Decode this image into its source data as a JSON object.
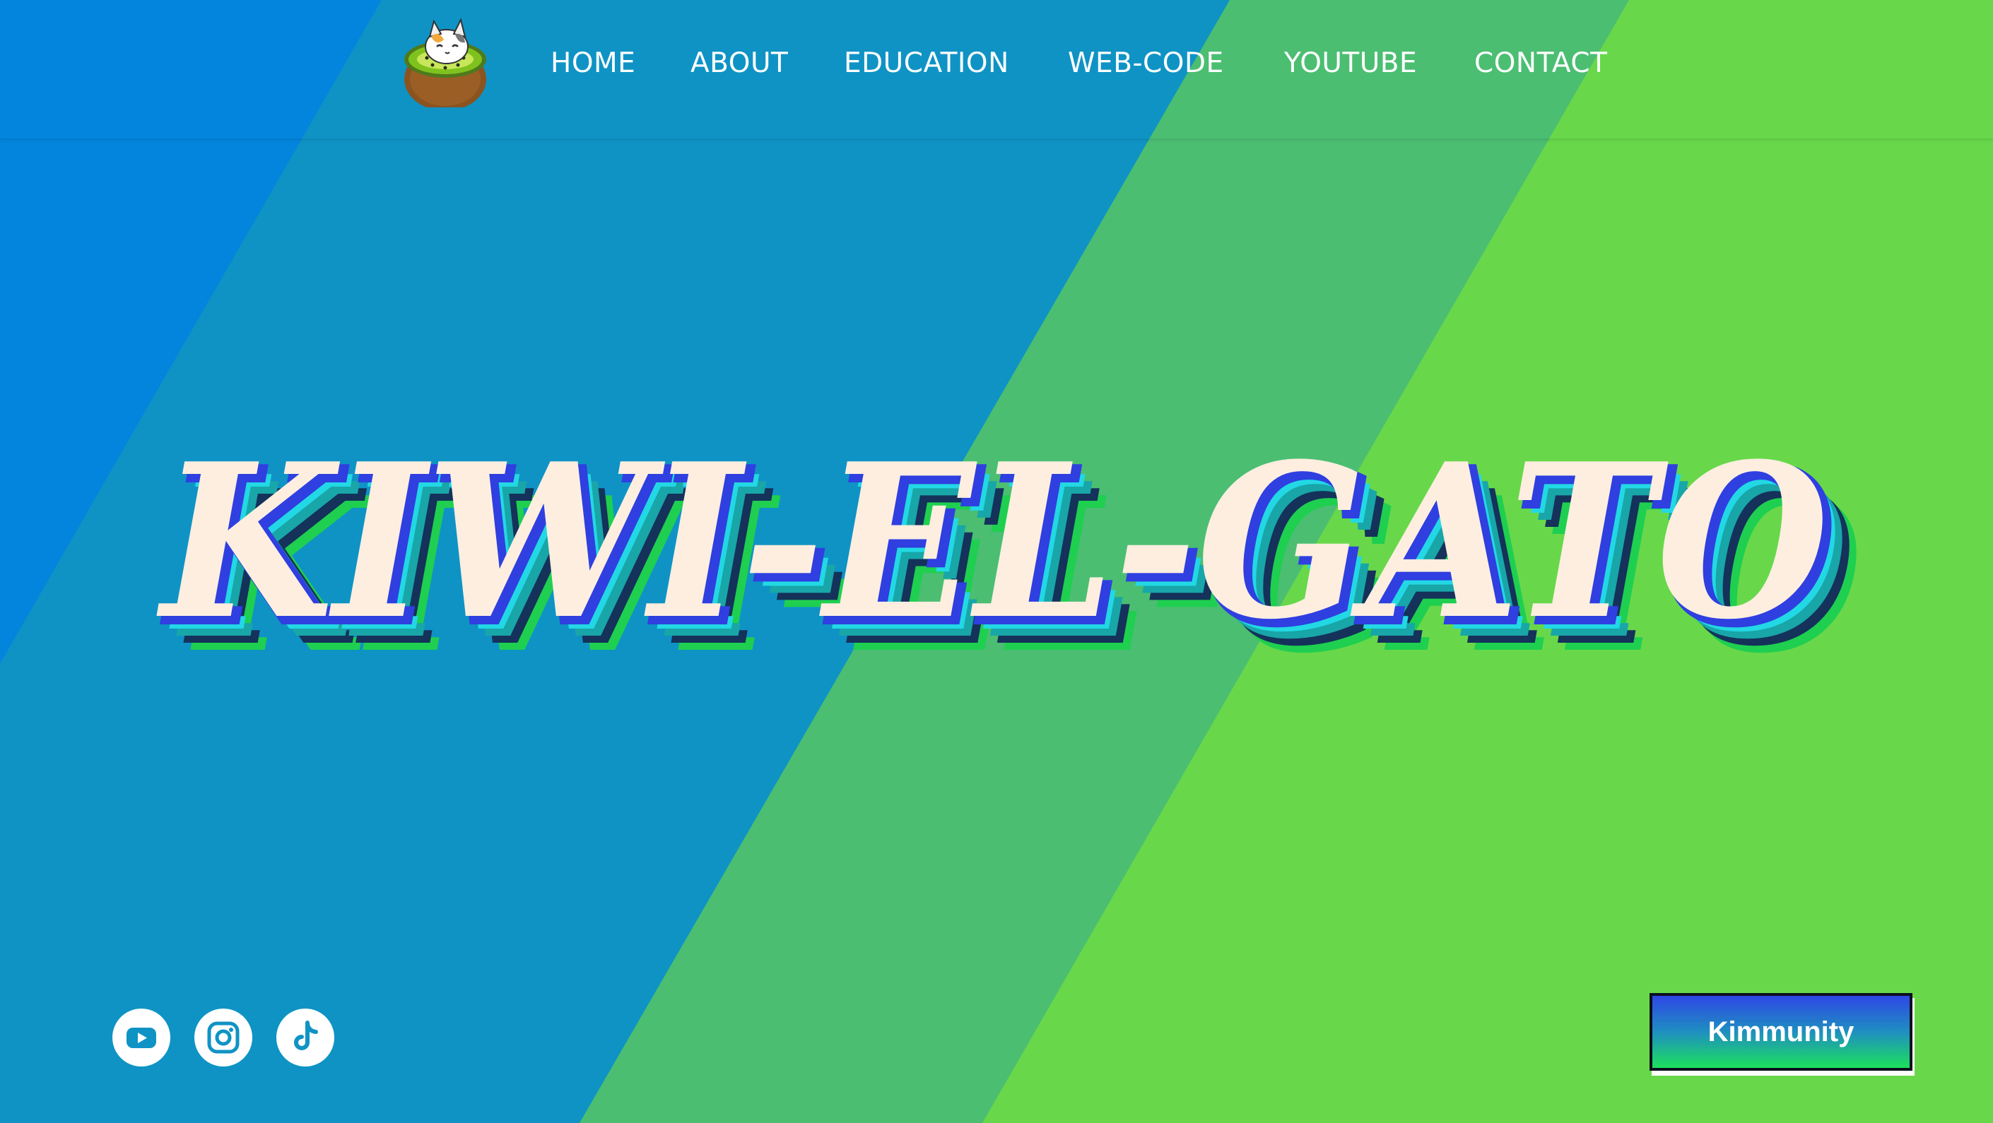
{
  "colors": {
    "band_blue": "#0385dd",
    "band_teal_blue": "#0f93c5",
    "band_sea_green": "#4bbe72",
    "band_lime": "#68d84a",
    "hero_face": "#fdeee0",
    "hero_outline": "#2f3fe0",
    "shadow_cyan": "#22d8e4",
    "shadow_teal": "#18a6a8",
    "shadow_navy": "#14325a",
    "shadow_green": "#1fcf50"
  },
  "header": {
    "logo_icon": "kiwi-cat-icon",
    "nav": [
      {
        "label": "HOME"
      },
      {
        "label": "ABOUT"
      },
      {
        "label": "EDUCATION"
      },
      {
        "label": "WEB-CODE"
      },
      {
        "label": "YOUTUBE"
      },
      {
        "label": "CONTACT"
      }
    ]
  },
  "hero": {
    "title": "KIWI-EL-GATO"
  },
  "social": [
    {
      "icon": "youtube-icon"
    },
    {
      "icon": "instagram-icon"
    },
    {
      "icon": "tiktok-icon"
    }
  ],
  "cta": {
    "label": "Kimmunity"
  }
}
